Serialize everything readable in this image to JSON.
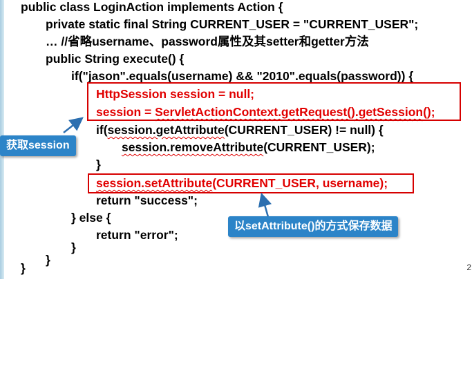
{
  "code": {
    "line1": "public class LoginAction implements Action {",
    "line2": "private static final String CURRENT_USER = \"CURRENT_USER\";",
    "line3": "… //省略username、password属性及其setter和getter方法",
    "line4": "public String execute() {",
    "line5": "if(\"jason\".equals(username) && \"2010\".equals(password)) {",
    "line6": "HttpSession session = null;",
    "line7a": "session = ",
    "line7b": "ServletActionContext.getRequest().getSession",
    "line7c": "();",
    "line8a": "if(",
    "line8b": "session.getAttribute",
    "line8c": "(CURRENT_USER) != null) {",
    "line9a": "session.removeAttribute",
    "line9b": "(CURRENT_USER);",
    "line10": "}",
    "line11a": "session.setAttribute",
    "line11b": "(CURRENT_USER, username);",
    "line12": "return \"success\";",
    "line13": "} else {",
    "line14": "return \"error\";",
    "line15": "}",
    "line16": "}",
    "line17": "}"
  },
  "callouts": {
    "get_session": "获取session",
    "set_attribute": "以setAttribute()的方式保存数据"
  },
  "page_number": "2",
  "colors": {
    "highlight_red": "#e10000",
    "box_border": "#d60000",
    "callout_bg": "#2c84c8"
  }
}
